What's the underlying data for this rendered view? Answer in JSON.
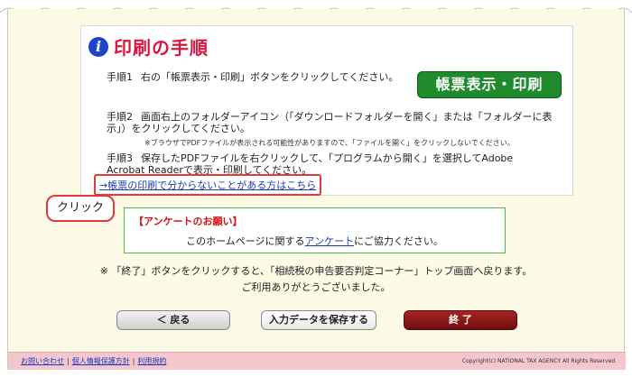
{
  "procedure": {
    "title": "印刷の手順",
    "step1_label": "手順1",
    "step1_text": "右の「帳票表示・印刷」ボタンをクリックしてください。",
    "report_button": "帳票表示・印刷",
    "step2_label": "手順2",
    "step2_text": "画面右上のフォルダーアイコン（「ダウンロードフォルダーを開く」または「フォルダーに表示」）をクリックしてください。",
    "step2_note": "※ブラウザでPDFファイルが表示される可能性がありますので、「ファイルを開く」をクリックしないでください。",
    "step3_label": "手順3",
    "step3_text": "保存したPDFファイルを右クリックして、「プログラムから開く」を選択してAdobe Acrobat Readerで表示・印刷してください。",
    "help_link": "→帳票の印刷で分からないことがある方はこちら"
  },
  "click_bubble": "クリック",
  "survey": {
    "title": "【アンケートのお願い】",
    "text_before": "このホームページに関する",
    "link": "アンケート",
    "text_after": "にご協力ください。"
  },
  "notice": {
    "line1": "※ 「終了」ボタンをクリックすると、「相続税の申告要否判定コーナー」トップ画面へ戻ります。",
    "line2": "ご利用ありがとうございました。"
  },
  "buttons": {
    "back": "＜ 戻る",
    "save": "入力データを保存する",
    "end": "終 了"
  },
  "footer": {
    "contact": "お問い合わせ",
    "privacy": "個人情報保護方針",
    "terms": "利用規約",
    "copyright": "Copyright(c) NATIONAL TAX AGENCY All Rights Reserved."
  },
  "colors": {
    "title_red": "#d6173f",
    "report_green": "#1f8b2c",
    "end_button": "#8b1a1a",
    "footer_pink": "#f4c7cf"
  }
}
